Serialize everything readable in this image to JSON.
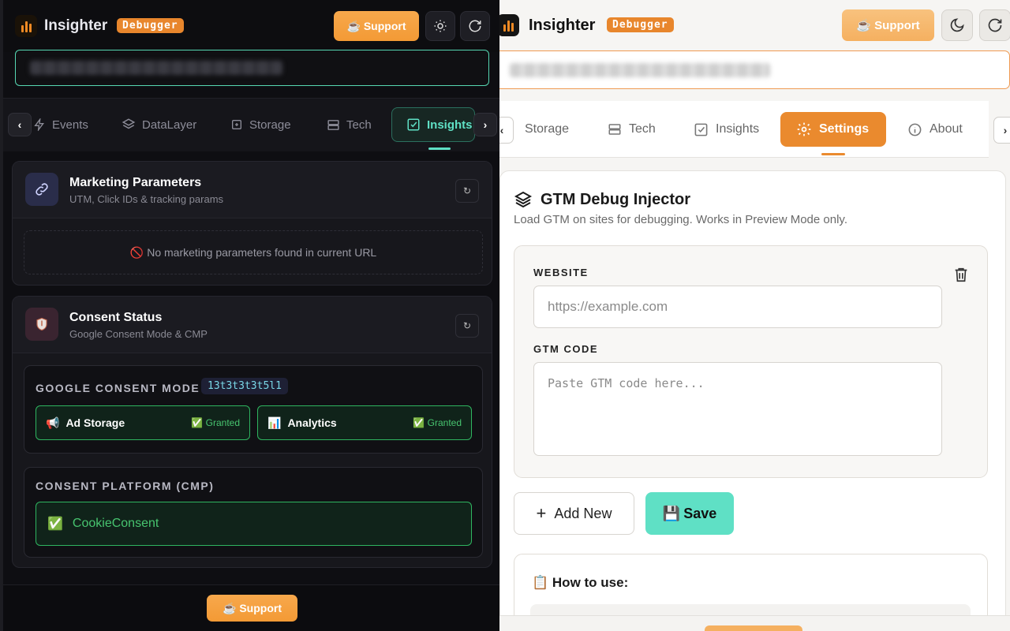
{
  "dark": {
    "header": {
      "brand": "Insighter",
      "badge": "Debugger",
      "support_label": "☕ Support"
    },
    "tabs": [
      {
        "label": "Events",
        "icon": "lightning-icon"
      },
      {
        "label": "DataLayer",
        "icon": "layers-icon"
      },
      {
        "label": "Storage",
        "icon": "storage-icon"
      },
      {
        "label": "Tech",
        "icon": "server-icon"
      },
      {
        "label": "Insights",
        "icon": "checkbox-icon",
        "active": true
      }
    ],
    "marketing": {
      "title": "Marketing Parameters",
      "subtitle": "UTM, Click IDs & tracking params",
      "empty_icon": "🚫",
      "empty_text": "No marketing parameters found in current URL",
      "refresh": "↻"
    },
    "consent": {
      "title": "Consent Status",
      "subtitle": "Google Consent Mode & CMP",
      "refresh": "↻",
      "gcm_label": "GOOGLE CONSENT MODE",
      "gcm_code": "13t3t3t3t5l1",
      "items": [
        {
          "icon": "📢",
          "label": "Ad Storage",
          "state_icon": "✅",
          "state": "Granted"
        },
        {
          "icon": "📊",
          "label": "Analytics",
          "state_icon": "✅",
          "state": "Granted"
        }
      ],
      "cmp_label": "CONSENT PLATFORM (CMP)",
      "cmp_icon": "✅",
      "cmp_value": "CookieConsent"
    },
    "footer": {
      "support_label": "☕ Support"
    }
  },
  "light": {
    "header": {
      "brand": "Insighter",
      "badge": "Debugger",
      "support_label": "☕ Support"
    },
    "tabs": [
      {
        "label": "Storage",
        "icon": "storage-icon"
      },
      {
        "label": "Tech",
        "icon": "server-icon"
      },
      {
        "label": "Insights",
        "icon": "checkbox-icon"
      },
      {
        "label": "Settings",
        "icon": "gear-icon",
        "active": true
      },
      {
        "label": "About",
        "icon": "info-icon"
      }
    ],
    "gtm": {
      "title": "GTM Debug Injector",
      "subtitle": "Load GTM on sites for debugging. Works in Preview Mode only.",
      "website_label": "WEBSITE",
      "website_placeholder": "https://example.com",
      "code_label": "GTM CODE",
      "code_placeholder": "Paste GTM code here...",
      "add_label": "Add New",
      "add_icon": "+",
      "save_icon": "💾",
      "save_label": "Save"
    },
    "how_to": {
      "icon": "📋",
      "title": "How to use:"
    }
  },
  "colors": {
    "accent": "#e8862c",
    "teal": "#56d7b2",
    "granted": "#2fb560",
    "save": "#5fe0c5"
  }
}
